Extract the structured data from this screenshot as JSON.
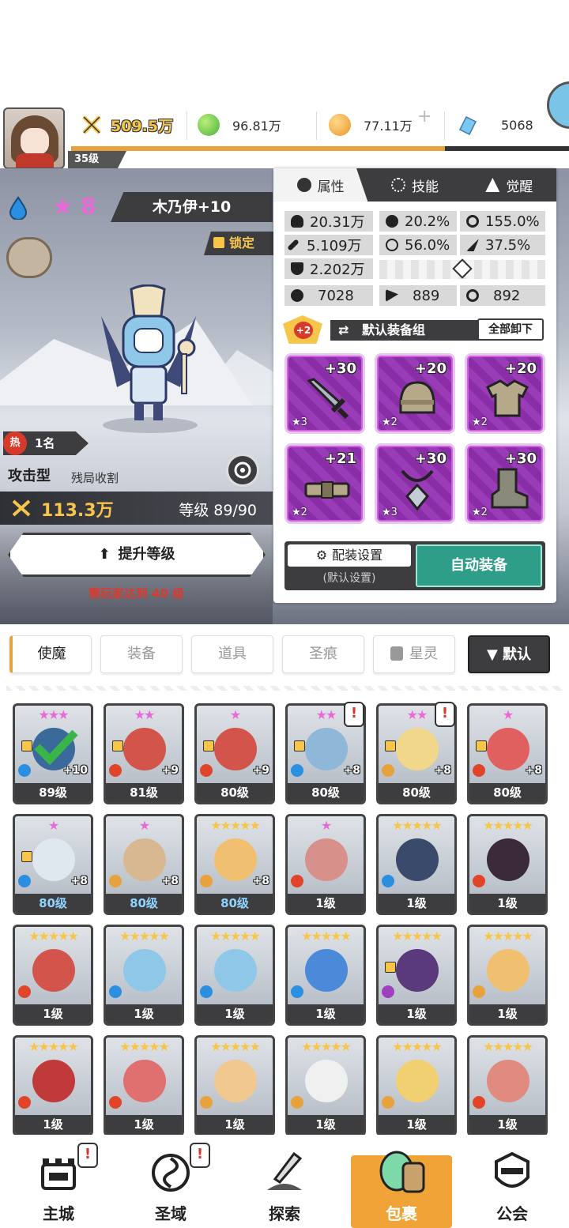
{
  "topbar": {
    "power": "509.5万",
    "green_currency": "96.81万",
    "gold_currency": "77.11万",
    "gems": "5068",
    "player_level": "35级",
    "exp_progress": 0.75
  },
  "hero": {
    "star_count": "8",
    "name": "木乃伊+10",
    "lock_label": "锁定",
    "hot_rank": "1名",
    "hot_label": "热",
    "type": "攻击型",
    "type_sub": "残局收割",
    "power": "113.3万",
    "level": "等级 89/90",
    "upgrade_label": "提升等级",
    "upgrade_requirement": "需玩家达到 40 级"
  },
  "panel": {
    "tabs": [
      {
        "label": "属性",
        "icon": "attribute-icon"
      },
      {
        "label": "技能",
        "icon": "skill-icon"
      },
      {
        "label": "觉醒",
        "icon": "awaken-icon"
      }
    ],
    "stats": {
      "hp": "20.31万",
      "crit_rate": "20.2%",
      "crit_damage": "155.0%",
      "attack": "5.109万",
      "accuracy": "56.0%",
      "speed": "37.5%",
      "defense": "2.202万",
      "stat_a": "7028",
      "stat_b": "889",
      "stat_c": "892"
    },
    "set_bonus": "+2",
    "set_label": "默认装备组",
    "unequip_all": "全部卸下",
    "equipment": [
      {
        "slot": "weapon",
        "plus": "+30",
        "stars": "★3"
      },
      {
        "slot": "helmet",
        "plus": "+20",
        "stars": "★2"
      },
      {
        "slot": "armor",
        "plus": "+20",
        "stars": "★2"
      },
      {
        "slot": "belt",
        "plus": "+21",
        "stars": "★2"
      },
      {
        "slot": "necklace",
        "plus": "+30",
        "stars": "★3"
      },
      {
        "slot": "boots",
        "plus": "+30",
        "stars": "★2"
      }
    ],
    "loadout_label": "配装设置",
    "loadout_sub": "(默认设置)",
    "auto_equip": "自动装备"
  },
  "filter_tabs": [
    "使魔",
    "装备",
    "道具",
    "圣痕",
    "星灵"
  ],
  "sort_label": "▼ 默认",
  "roster": [
    {
      "level": "89级",
      "stars": "★★★",
      "star_color": "#e86ad8",
      "plus": "+10",
      "element": "#2a8fe0",
      "locked": true,
      "head": "#3a6a9a",
      "alert": false,
      "blue": false
    },
    {
      "level": "81级",
      "stars": "★★",
      "star_color": "#e86ad8",
      "plus": "+9",
      "element": "#e0452a",
      "locked": true,
      "head": "#d2544a",
      "alert": false,
      "blue": false
    },
    {
      "level": "80级",
      "stars": "★",
      "star_color": "#e86ad8",
      "plus": "+9",
      "element": "#e0452a",
      "locked": true,
      "head": "#d2544a",
      "alert": false,
      "blue": false
    },
    {
      "level": "80级",
      "stars": "★★",
      "star_color": "#e86ad8",
      "plus": "+8",
      "element": "#2a8fe0",
      "locked": true,
      "head": "#8fb7d8",
      "alert": true,
      "blue": false
    },
    {
      "level": "80级",
      "stars": "★★",
      "star_color": "#e86ad8",
      "plus": "+8",
      "element": "#e8a23d",
      "locked": true,
      "head": "#f0d78a",
      "alert": true,
      "blue": false
    },
    {
      "level": "80级",
      "stars": "★",
      "star_color": "#e86ad8",
      "plus": "+8",
      "element": "#e0452a",
      "locked": true,
      "head": "#e06060",
      "alert": false,
      "blue": false
    },
    {
      "level": "80级",
      "stars": "★",
      "star_color": "#e86ad8",
      "plus": "+8",
      "element": "#2a8fe0",
      "locked": true,
      "head": "#dfe7ef",
      "alert": false,
      "blue": true
    },
    {
      "level": "80级",
      "stars": "★",
      "star_color": "#e86ad8",
      "plus": "+8",
      "element": "#e8a23d",
      "locked": false,
      "head": "#d8b890",
      "alert": false,
      "blue": true
    },
    {
      "level": "80级",
      "stars": "★★★★★",
      "star_color": "#f6c54a",
      "plus": "+8",
      "element": "#e8a23d",
      "locked": false,
      "head": "#f0c070",
      "alert": false,
      "blue": true
    },
    {
      "level": "1级",
      "stars": "★",
      "star_color": "#e86ad8",
      "plus": "",
      "element": "#e0452a",
      "locked": false,
      "head": "#d8908a",
      "alert": false,
      "blue": false
    },
    {
      "level": "1级",
      "stars": "★★★★★",
      "star_color": "#f6c54a",
      "plus": "",
      "element": "#2a8fe0",
      "locked": false,
      "head": "#3a4a6a",
      "alert": false,
      "blue": false
    },
    {
      "level": "1级",
      "stars": "★★★★★",
      "star_color": "#f6c54a",
      "plus": "",
      "element": "#e0452a",
      "locked": false,
      "head": "#3a2a3a",
      "alert": false,
      "blue": false
    },
    {
      "level": "1级",
      "stars": "★★★★★",
      "star_color": "#f6c54a",
      "plus": "",
      "element": "#e0452a",
      "locked": false,
      "head": "#d2544a",
      "alert": false,
      "blue": false
    },
    {
      "level": "1级",
      "stars": "★★★★★",
      "star_color": "#f6c54a",
      "plus": "",
      "element": "#2a8fe0",
      "locked": false,
      "head": "#8fc7e8",
      "alert": false,
      "blue": false
    },
    {
      "level": "1级",
      "stars": "★★★★★",
      "star_color": "#f6c54a",
      "plus": "",
      "element": "#2a8fe0",
      "locked": false,
      "head": "#8fc7e8",
      "alert": false,
      "blue": false
    },
    {
      "level": "1级",
      "stars": "★★★★★",
      "star_color": "#f6c54a",
      "plus": "",
      "element": "#2a8fe0",
      "locked": false,
      "head": "#4a8ad8",
      "alert": false,
      "blue": false
    },
    {
      "level": "1级",
      "stars": "★★★★★",
      "star_color": "#f6c54a",
      "plus": "",
      "element": "#a040c0",
      "locked": true,
      "head": "#5a3a7a",
      "alert": false,
      "blue": false
    },
    {
      "level": "1级",
      "stars": "★★★★★",
      "star_color": "#f6c54a",
      "plus": "",
      "element": "#e8a23d",
      "locked": false,
      "head": "#f0c070",
      "alert": false,
      "blue": false
    },
    {
      "level": "1级",
      "stars": "★★★★★",
      "star_color": "#f6c54a",
      "plus": "",
      "element": "#e0452a",
      "locked": false,
      "head": "#c03a3a",
      "alert": false,
      "blue": false
    },
    {
      "level": "1级",
      "stars": "★★★★★",
      "star_color": "#f6c54a",
      "plus": "",
      "element": "#e0452a",
      "locked": false,
      "head": "#e07070",
      "alert": false,
      "blue": false
    },
    {
      "level": "1级",
      "stars": "★★★★★",
      "star_color": "#f6c54a",
      "plus": "",
      "element": "#e8a23d",
      "locked": false,
      "head": "#f0c890",
      "alert": false,
      "blue": false
    },
    {
      "level": "1级",
      "stars": "★★★★★",
      "star_color": "#f6c54a",
      "plus": "",
      "element": "#e8a23d",
      "locked": false,
      "head": "#f0f0f0",
      "alert": false,
      "blue": false
    },
    {
      "level": "1级",
      "stars": "★★★★★",
      "star_color": "#f6c54a",
      "plus": "",
      "element": "#e8a23d",
      "locked": false,
      "head": "#f0d070",
      "alert": false,
      "blue": false
    },
    {
      "level": "1级",
      "stars": "★★★★★",
      "star_color": "#f6c54a",
      "plus": "",
      "element": "#e0452a",
      "locked": false,
      "head": "#e08a80",
      "alert": false,
      "blue": false
    }
  ],
  "nav": [
    {
      "label": "主城",
      "icon": "castle-icon",
      "alert": true
    },
    {
      "label": "圣域",
      "icon": "vortex-icon",
      "alert": true
    },
    {
      "label": "探索",
      "icon": "sword-icon",
      "alert": false
    },
    {
      "label": "包裹",
      "icon": "bag-icon",
      "alert": false
    },
    {
      "label": "公会",
      "icon": "guild-icon",
      "alert": false
    }
  ]
}
